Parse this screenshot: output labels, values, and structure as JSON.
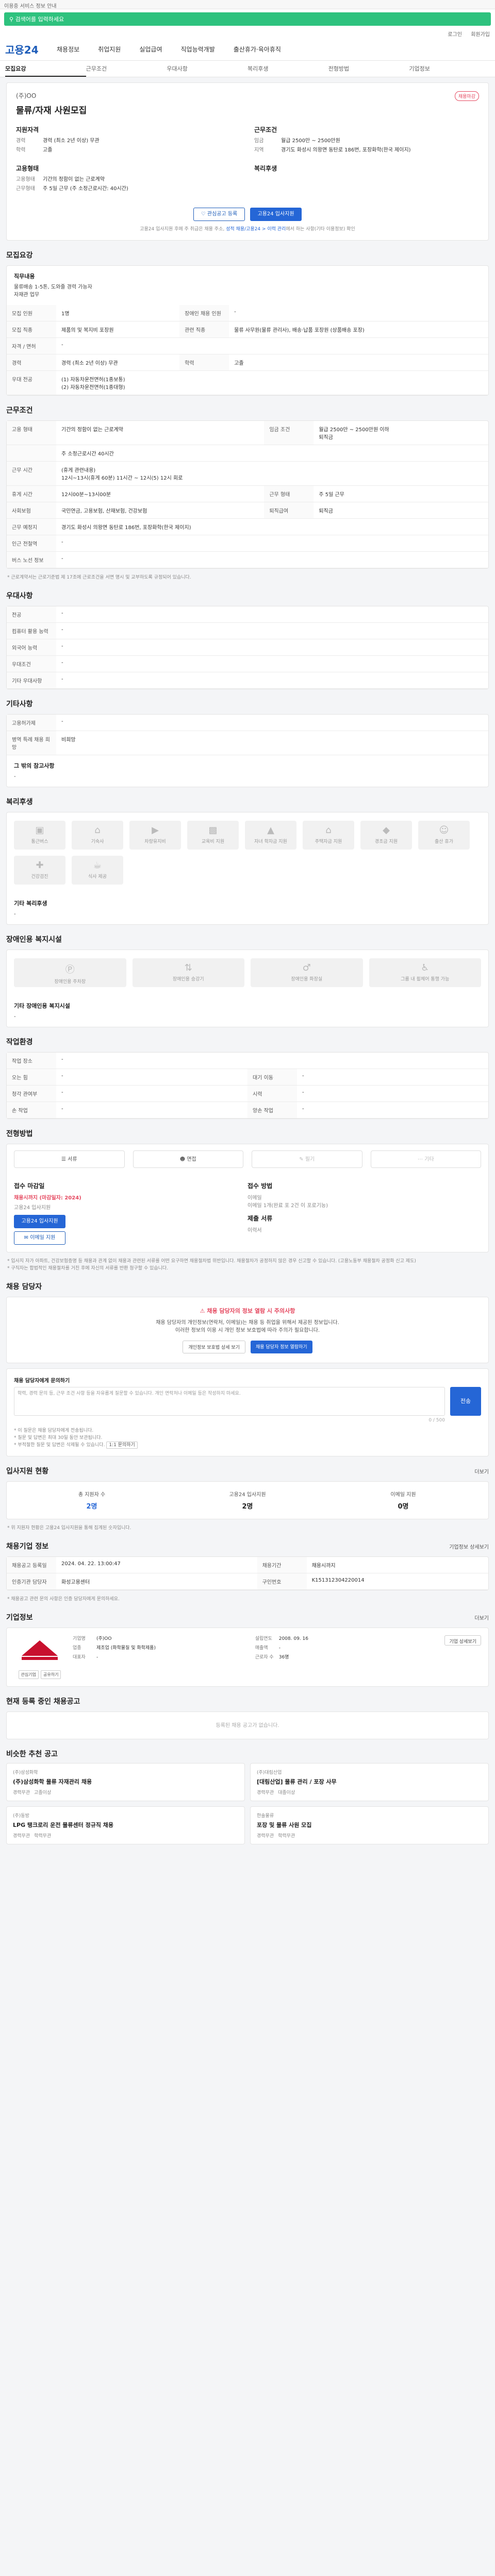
{
  "top": {
    "notice": "이용중 서비스 정보 안내"
  },
  "search": {
    "text": "검색어를 입력하세요"
  },
  "tools": [
    "로그인",
    "회원가입"
  ],
  "brand": {
    "logo": "고용24"
  },
  "gnb": [
    "채용정보",
    "취업지원",
    "실업급여",
    "직업능력개발",
    "출산휴가·육아휴직"
  ],
  "tabs": [
    "모집요강",
    "근무조건",
    "우대사항",
    "복리후생",
    "전형방법",
    "기업정보"
  ],
  "job": {
    "company": "(주)OO",
    "title": "물류/자재 사원모집",
    "badge": "채용마감",
    "left_head": "지원자격",
    "left_rows": [
      {
        "k": "경력",
        "v": "경력 (최소 2년 이상) 무관"
      },
      {
        "k": "학력",
        "v": "고졸"
      }
    ],
    "right_head": "근무조건",
    "right_rows": [
      {
        "k": "임금",
        "v": "월급 2500만 ~ 2500만원"
      },
      {
        "k": "지역",
        "v": "경기도 화성시 의왕면 동탄로 186번, 포장화학(한국 제이지)"
      }
    ],
    "left2_head": "고용형태",
    "left2_rows": [
      {
        "k": "고용형태",
        "v": "기간의 정함이 없는 근로계약"
      },
      {
        "k": "근무형태",
        "v": "주 5일 근무 (주 소정근로시간: 40시간)"
      }
    ],
    "right2_head": "복리후생",
    "btn_scrap": "관심공고 등록",
    "btn_apply": "고용24 입사지원",
    "notice_pre": "고용24 입사지원 후에 주 취급은 채용 주소, ",
    "notice_hl": "성적 채용/고용24 > 이력 관리",
    "notice_post": "에서 하는 사항(기타 이용정보) 확인"
  },
  "recruit": {
    "title": "모집요강",
    "duty_head": "직무내용",
    "duty_text": "물류배송 1-5톤, 도와줄 경력 가능자\n자재관 업무",
    "rows": [
      {
        "k1": "모집 인원",
        "v1": "1명",
        "k2": "장애인 채용 인원",
        "v2": "-"
      },
      {
        "k1": "모집 직종",
        "v1": "제품의 및 복지비 포장원",
        "k2": "관련 직종",
        "v2": "물류 사무원(물류 관리사), 배송·납품 포장원 (상품배송 포장)"
      },
      {
        "k1": "자격 / 면허",
        "v1": "-",
        "k2": "",
        "v2": ""
      },
      {
        "k1": "경력",
        "v1": "경력 (최소 2년 이상) 무관",
        "k2": "학력",
        "v2": "고졸"
      },
      {
        "k1": "우대 전공",
        "v1": "(1) 자동차운전면허(1종보통)\n(2) 자동차운전면허(1종대형)",
        "k2": "",
        "v2": ""
      }
    ]
  },
  "work": {
    "title": "근무조건",
    "rows": [
      {
        "k1": "고용 형태",
        "v1": "기간의 정함이 없는 근로계약",
        "k2": "임금 조건",
        "v2": "월급 2500만 ~ 2500만원 이하\n퇴직금"
      },
      {
        "k1": "",
        "v1": "주 소정근로시간 40시간",
        "k2": "",
        "v2": ""
      },
      {
        "k1": "근무 시간",
        "v1": "(휴게 관련내용)\n12시~13시(휴게 60분) 11시간 ~ 12시(5) 12시 회로",
        "k2": "",
        "v2": ""
      },
      {
        "k1": "휴게 시간",
        "v1": "12시00분~13시00분",
        "k2": "근무 형태",
        "v2": "주 5일 근무"
      },
      {
        "k1": "사회보험",
        "v1": "국민연금, 고용보험, 산재보험, 건강보험",
        "k2": "퇴직급여",
        "v2": "퇴직금"
      },
      {
        "k1": "근무 예정지",
        "v1": "경기도 화성시 의왕면 동탄로 186번, 포장화학(한국 제이지)",
        "k2": "",
        "v2": ""
      },
      {
        "k1": "인근 전철역",
        "v1": "-",
        "k2": "",
        "v2": ""
      },
      {
        "k1": "버스 노선 정보",
        "v1": "-",
        "k2": "",
        "v2": ""
      }
    ],
    "footnote": "* 근로계약서는 근로기준법 제 17조에 근로조건을 서면 명시 및 교부하도록 규정되어 있습니다."
  },
  "prefer": {
    "title": "우대사항",
    "rows": [
      {
        "k": "전공",
        "v": "-"
      },
      {
        "k": "컴퓨터 활용 능력",
        "v": "-"
      },
      {
        "k": "외국어 능력",
        "v": "-"
      },
      {
        "k": "우대조건",
        "v": "-"
      },
      {
        "k": "기타 우대사항",
        "v": "-"
      }
    ]
  },
  "etc": {
    "title": "기타사항",
    "rows": [
      {
        "k": "고용허가제",
        "v": "-"
      },
      {
        "k": "병역 특례 채용 희망",
        "v": "비희망"
      }
    ],
    "extra_head": "그 밖의 참고사항",
    "extra_text": "-"
  },
  "welfare": {
    "title": "복리후생",
    "items": [
      "통근버스",
      "기숙사",
      "차량유지비",
      "교육비 지원",
      "자녀 학자금 지원",
      "주택자금 지원",
      "경조금 지원",
      "출산 휴가",
      "건강검진",
      "식사 제공"
    ],
    "other_head": "기타 복리후생",
    "other_text": "-"
  },
  "disabled": {
    "title": "장애인용 복지시설",
    "items": [
      "장애인용 주차장",
      "장애인용 승강기",
      "장애인용 화장실",
      "그룹 내 휠체어 통행 가능"
    ],
    "other_head": "기타 장애인용 복지시설",
    "other_text": "-"
  },
  "env": {
    "title": "작업환경",
    "rows": [
      {
        "k1": "작업 장소",
        "v1": "-",
        "k2": "",
        "v2": ""
      },
      {
        "k1": "오는 힘",
        "v1": "-",
        "k2": "대기 이동",
        "v2": "-"
      },
      {
        "k1": "청각 관여부",
        "v1": "-",
        "k2": "시력",
        "v2": "-"
      },
      {
        "k1": "손 작업",
        "v1": "-",
        "k2": "양손 작업",
        "v2": "-"
      }
    ]
  },
  "apply": {
    "title": "전형방법",
    "methods": [
      "서류",
      "면접",
      "필기",
      "기타"
    ],
    "left_head": "접수 마감일",
    "left_deadline": "채용시까지 (마감일자: 2024)",
    "left_method": "고용24 입사지원",
    "btn_apply": "고용24 입사지원",
    "btn_email": "이메일 지원",
    "right_head": "접수 방법",
    "right_lines": [
      "이메일",
      "이메일 1개(완료 포 2건 이 포로기능)"
    ],
    "right_head2": "제출 서류",
    "right_doc": "이력서",
    "footnote": "* 입사지 자가 아파트, 건강보험증명 등 채용과 관계 없이 채용과 관련된 서류를 어떤 요구하면 채용절차법 위반입니다. 채용절차가 공정하지 않은 경우 신고할 수 있습니다. (고용노동부 채용절차 공정화 신고 제도)\n* 구직자는 합법적인 채용절차를 거친 후에 자신의 서류를 반환 청구할 수 있습니다."
  },
  "contact": {
    "title": "채용 담당자",
    "alert": "채용 담당자의 정보 열람 시 주의사항",
    "lines": [
      "채용 담당자의 개인정보(연락처, 이메일)는 채용 등 취업을 위해서 제공된 정보입니다.",
      "이러한 정보의 이용 시 개인 정보 보호법에 따라 주의가 필요합니다."
    ],
    "btn1": "개인정보 보호법 상세 보기",
    "btn2": "채용 담당자 정보 열람하기",
    "q_label": "채용 담당자에게 문의하기",
    "q_placeholder": "학력, 경력 문의 등, 근무 조건 사항 등을 자유롭게 질문할 수 있습니다. 개인 연락처나 이메일 등은 작성하지 마세요.",
    "q_count": "0 / 500",
    "q_send": "전송",
    "notes": [
      "* 이 질문은 채용 담당자에게 전송됩니다.",
      "* 질문 및 답변은 최대 30일 동안 보관됩니다.",
      "* 부적절한 질문 및 답변은 삭제될 수 있습니다."
    ],
    "tag": "1:1 문의하기"
  },
  "stats": {
    "title": "입사지원 현황",
    "link": "더보기",
    "items": [
      {
        "label": "총 지원자 수",
        "value": "2명"
      },
      {
        "label": "고용24 입사지원",
        "value": "2명"
      },
      {
        "label": "이메일 지원",
        "value": "0명"
      }
    ],
    "footnote": "* 위 지원자 현황은 고용24 입사지원을 통해 집계된 숫자입니다."
  },
  "info": {
    "title": "채용기업 정보",
    "link": "기업정보 상세보기",
    "rows": [
      {
        "k1": "채용공고 등록일",
        "v1": "2024. 04. 22. 13:00:47",
        "k2": "채용기간",
        "v2": "채용시까지"
      },
      {
        "k1": "인증기관 담당자",
        "v1": "화성고용센터",
        "k2": "구인번호",
        "v2": "K151312304220014"
      }
    ],
    "footnote": "* 채용공고 관련 문의 사항은 인증 담당자에게 문의하세요."
  },
  "company": {
    "title": "기업정보",
    "link": "더보기",
    "logo_btns": [
      "관심기업",
      "공유하기"
    ],
    "rows_l": [
      {
        "k": "기업명",
        "v": "(주)OO"
      },
      {
        "k": "업종",
        "v": "제조업 (화학물질 및 화학제품)"
      },
      {
        "k": "대표자",
        "v": "-"
      }
    ],
    "rows_r": [
      {
        "k": "설립연도",
        "v": "2008. 09. 16"
      },
      {
        "k": "매출액",
        "v": "-"
      },
      {
        "k": "근로자 수",
        "v": "36명"
      }
    ],
    "btn": "기업 상세보기"
  },
  "same_co": {
    "title": "현재 등록 중인 채용공고",
    "empty": "등록된 채용 공고가 없습니다."
  },
  "related": {
    "title": "비슷한 추천 공고",
    "items": [
      {
        "co": "(주)삼성화학",
        "title": "(주)삼성화학 물류 자재관리 채용",
        "meta": [
          "경력무관",
          "고졸이상"
        ]
      },
      {
        "co": "(주)대림산업",
        "title": "[대림산업] 물류 관리 / 포장 사무",
        "meta": [
          "경력무관",
          "대졸이상"
        ]
      },
      {
        "co": "(주)동방",
        "title": "LPG 탱크로리 운전 물류센터 정규직 채용",
        "meta": [
          "경력무관",
          "학력무관"
        ]
      },
      {
        "co": "한솔물류",
        "title": "포장 및 물류 사원 모집",
        "meta": [
          "경력무관",
          "학력무관"
        ]
      }
    ]
  },
  "colors": {
    "brand": "#2566d6",
    "search": "#2ec27e",
    "accent": "#e5485f"
  }
}
